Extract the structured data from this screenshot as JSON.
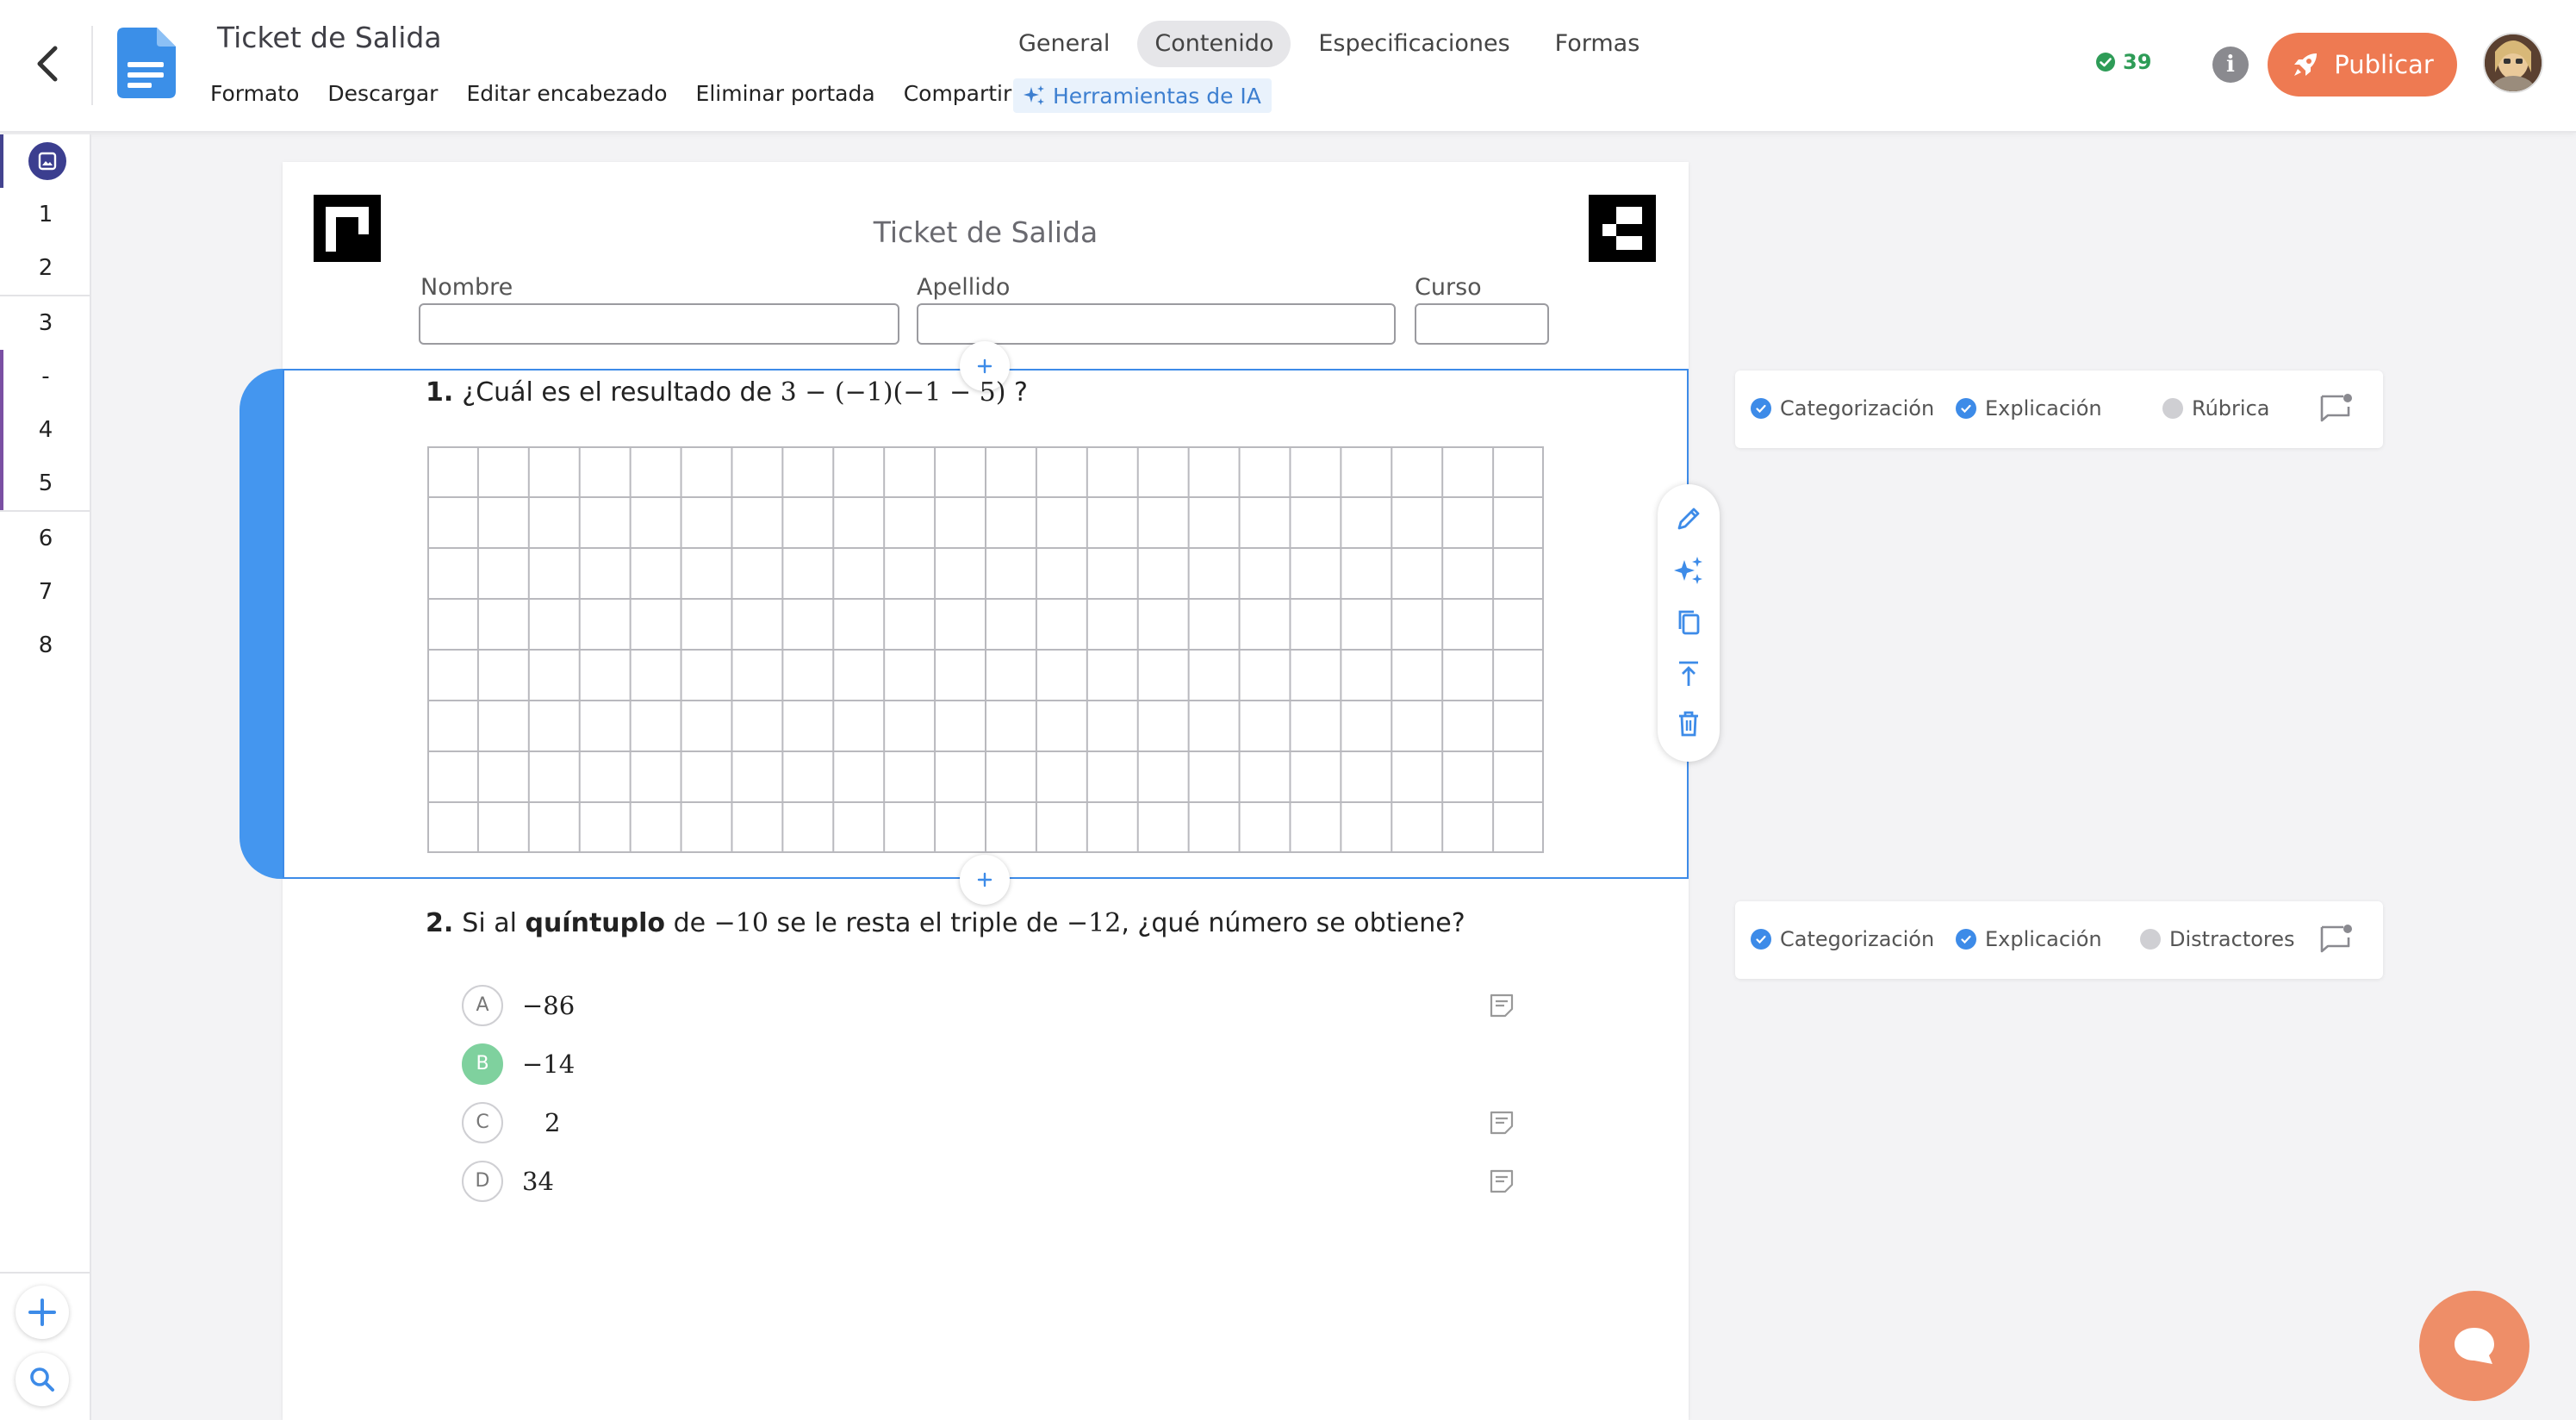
{
  "header": {
    "title": "Ticket de Salida",
    "menu": [
      "Formato",
      "Descargar",
      "Editar encabezado",
      "Eliminar portada",
      "Compartir"
    ],
    "tabs": [
      "General",
      "Contenido",
      "Especificaciones",
      "Formas"
    ],
    "active_tab": "Contenido",
    "ai_tools_label": "Herramientas de IA",
    "check_count": "39",
    "publish_label": "Publicar",
    "accent_color": "#ee7a52"
  },
  "nav": {
    "items": [
      "1",
      "2",
      "3",
      "-",
      "4",
      "5",
      "6",
      "7",
      "8"
    ],
    "cover_icon": "image-icon",
    "add_icon": "plus-icon",
    "search_icon": "search-icon"
  },
  "page": {
    "title": "Ticket de Salida",
    "fields": {
      "nombre": "Nombre",
      "apellido": "Apellido",
      "curso": "Curso"
    }
  },
  "questions": [
    {
      "number": "1.",
      "text_before": "¿Cuál es el resultado de",
      "math": "3 − (−1)(−1 − 5)",
      "text_after": "?",
      "answer_grid": {
        "cols": 22,
        "rows": 8
      }
    },
    {
      "number": "2.",
      "text_pre": "Si al",
      "text_bold": "quíntuplo",
      "text_de": "de",
      "math_a": "−10",
      "text_mid": "se le resta el triple de",
      "math_b": "−12",
      "text_end": ", ¿qué número se obtiene?",
      "options": [
        {
          "letter": "A",
          "value": "−86",
          "correct": false
        },
        {
          "letter": "B",
          "value": "−14",
          "correct": true
        },
        {
          "letter": "C",
          "value": "2",
          "correct": false
        },
        {
          "letter": "D",
          "value": "34",
          "correct": false
        }
      ]
    }
  ],
  "panels": [
    {
      "items": [
        "Categorización",
        "Explicación",
        "Rúbrica"
      ],
      "states": [
        true,
        true,
        false
      ]
    },
    {
      "items": [
        "Categorización",
        "Explicación",
        "Distractores"
      ],
      "states": [
        true,
        true,
        false
      ]
    }
  ],
  "toolbar_icons": [
    "pencil-icon",
    "sparkles-icon",
    "copy-icon",
    "move-to-top-icon",
    "trash-icon"
  ],
  "colors": {
    "selection_blue": "#3d8be8",
    "correct_green": "#7fd19e",
    "chat_fab": "#ee8e68"
  }
}
